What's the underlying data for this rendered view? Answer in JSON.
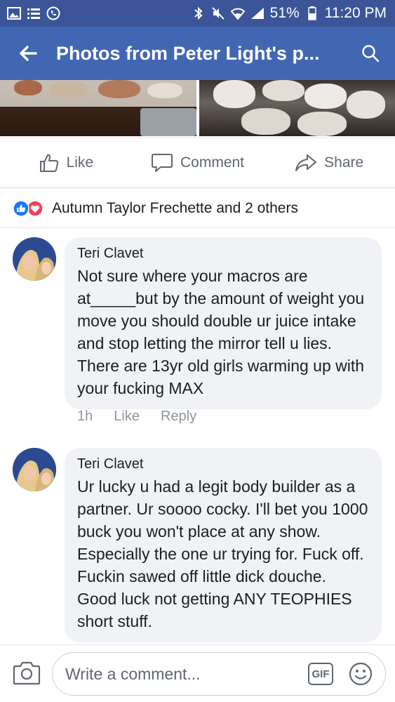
{
  "statusbar": {
    "battery": "51%",
    "time": "11:20 PM"
  },
  "appbar": {
    "title": "Photos from Peter Light's p..."
  },
  "actions": {
    "like": "Like",
    "comment": "Comment",
    "share": "Share"
  },
  "reactions": {
    "text": "Autumn Taylor Frechette and 2 others"
  },
  "comments": [
    {
      "author": "Teri Clavet",
      "text": "Not sure where your macros are at_____but by the amount of weight you move you should double ur juice intake and stop letting the mirror tell u lies.  There are 13yr old girls warming up with your fucking MAX",
      "time": "1h",
      "like": "Like",
      "reply": "Reply"
    },
    {
      "author": "Teri Clavet",
      "text": "Ur lucky u had a legit body builder as a partner. Ur soooo cocky. I'll bet you 1000 buck you won't place at any show. Especially the one ur trying for. Fuck off. Fuckin sawed off little dick douche.  Good luck not getting ANY TEOPHIES short stuff."
    }
  ],
  "composer": {
    "placeholder": "Write a comment...",
    "gif": "GIF"
  },
  "colors": {
    "statusbar": "#3b5598",
    "appbar": "#4267b2",
    "like_blue": "#1877f2",
    "love_red": "#f33e58"
  }
}
